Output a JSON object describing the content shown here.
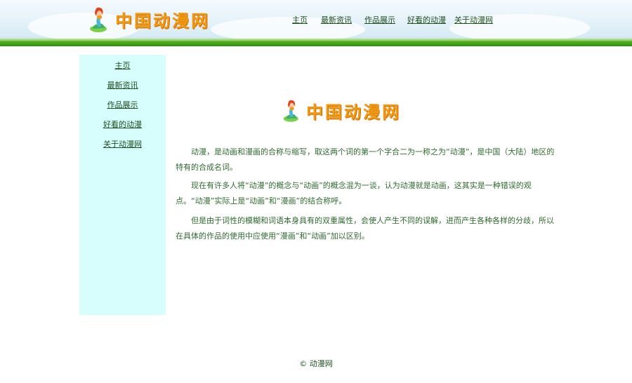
{
  "header": {
    "logo_text": "中国动漫网",
    "nav": [
      "主页",
      "最新资讯",
      "作品展示",
      "好看的动漫",
      "关于动漫网"
    ]
  },
  "sidebar": {
    "items": [
      "主页",
      "最新资讯",
      "作品展示",
      "好看的动漫",
      "关于动漫网"
    ]
  },
  "main": {
    "logo_text": "中国动漫网",
    "paragraphs": [
      "动漫，是动画和漫画的合称与缩写，取这两个词的第一个字合二为一称之为“动漫”，是中国（大陆）地区的特有的合成名词。",
      "现在有许多人将“动漫”的概念与“动画”的概念混为一谈，认为动漫就是动画，这其实是一种错误的观点。“动漫”实际上是“动画”和“漫画”的结合称呼。",
      "但是由于词性的模糊和词语本身具有的双重属性，会使人产生不同的误解，进而产生各种各样的分歧，所以在具体的作品的使用中应使用“漫画”和“动画”加以区别。"
    ]
  },
  "footer": {
    "text": "© 动漫网"
  },
  "colors": {
    "accent": "#f29a14",
    "green_bar": "#4fae1e",
    "sidebar_bg": "#d7fdfd",
    "link": "#1d4f1d"
  },
  "icons": {
    "logo_mascot": "mermaid-mascot-icon"
  }
}
